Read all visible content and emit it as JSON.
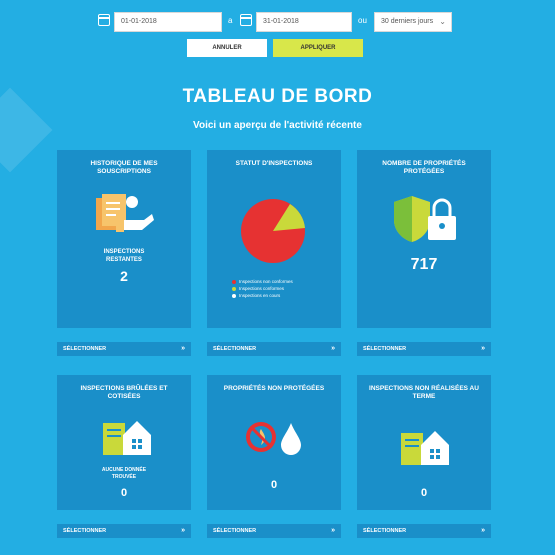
{
  "filters": {
    "date_from": "01-01-2018",
    "date_to": "31-01-2018",
    "period": "30 derniers jours",
    "cancel_label": "ANNULER",
    "apply_label": "APPLIQUER"
  },
  "header": {
    "title": "TABLEAU DE BORD",
    "subtitle": "Voici un aperçu de l'activité récente"
  },
  "cards": [
    {
      "title": "HISTORIQUE DE MES SOUSCRIPTIONS",
      "label": "INSPECTIONS RESTANTES",
      "value": "2",
      "icon": "documents-hand-icon",
      "footer": "SÉLECTIONNER"
    },
    {
      "title": "STATUT D'INSPECTIONS",
      "icon": "pie-chart-icon",
      "footer": "SÉLECTIONNER",
      "legend": [
        "Inspections non conformes",
        "Inspections conformes",
        "Inspections en cours"
      ],
      "colors": {
        "non_conforme": "#e63232",
        "conforme": "#c9d93a"
      }
    },
    {
      "title": "NOMBRE DE PROPRIÉTÉS PROTÉGÉES",
      "value": "717",
      "icon": "shield-lock-icon",
      "footer": "SÉLECTIONNER"
    },
    {
      "title": "INSPECTIONS BRÛLÉES ET COTISÉES",
      "label": "AUCUNE DONNÉE TROUVÉE",
      "value": "0",
      "icon": "house-document-icon",
      "footer": "SÉLECTIONNER"
    },
    {
      "title": "PROPRIÉTÉS NON PROTÉGÉES",
      "value": "0",
      "icon": "no-fire-water-icon",
      "footer": "SÉLECTIONNER"
    },
    {
      "title": "INSPECTIONS NON RÉALISÉES AU TERME",
      "value": "0",
      "icon": "house-document-icon",
      "footer": "SÉLECTIONNER"
    }
  ],
  "colors": {
    "background": "#23aee3",
    "card": "#1a8fc9",
    "accent": "#d8e74a"
  }
}
